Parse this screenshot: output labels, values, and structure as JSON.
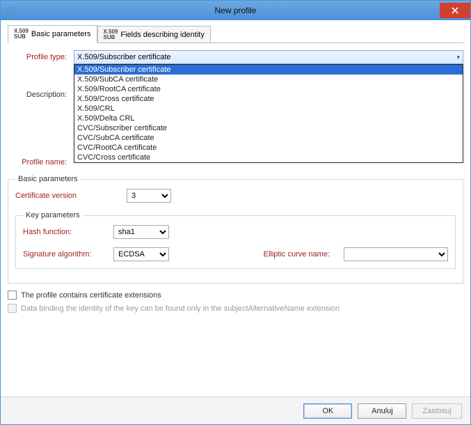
{
  "window": {
    "title": "New profile"
  },
  "tabs": [
    {
      "label": "Basic parameters",
      "active": true
    },
    {
      "label": "Fields describing identity",
      "active": false
    }
  ],
  "form": {
    "profile_type_label": "Profile type:",
    "profile_type_value": "X.509/Subscriber certificate",
    "profile_type_options": [
      "X.509/Subscriber certificate",
      "X.509/SubCA certificate",
      "X.509/RootCA certificate",
      "X.509/Cross certificate",
      "X.509/CRL",
      "X.509/Delta CRL",
      "CVC/Subscriber certificate",
      "CVC/SubCA certificate",
      "CVC/RootCA certificate",
      "CVC/Cross certificate"
    ],
    "profile_name_label": "Profile name:",
    "description_label": "Description:"
  },
  "basic_params": {
    "legend": "Basic parameters",
    "cert_version_label": "Certificate version",
    "cert_version_value": "3",
    "key_params_legend": "Key parameters",
    "hash_label": "Hash function:",
    "hash_value": "sha1",
    "sig_label": "Signature algorithm:",
    "sig_value": "ECDSA",
    "curve_label": "Elliptic curve name:",
    "curve_value": ""
  },
  "checkboxes": {
    "ext_label": "The profile contains certificate extensions",
    "san_label": "Data binding the identity of the key can be found only in the subjectAlternativeName extension"
  },
  "footer": {
    "ok": "OK",
    "cancel": "Anuluj",
    "apply": "Zastosuj"
  }
}
